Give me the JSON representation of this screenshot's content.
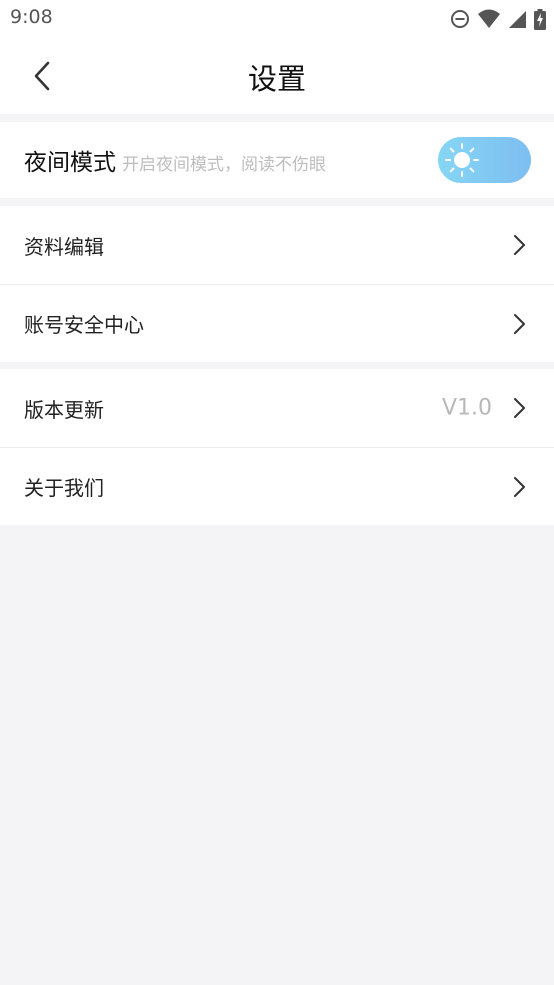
{
  "status_bar": {
    "time": "9:08",
    "icons": [
      "do-not-disturb-icon",
      "wifi-icon",
      "signal-icon",
      "battery-charging-icon"
    ]
  },
  "header": {
    "title": "设置",
    "back_icon": "chevron-left-icon"
  },
  "night_mode": {
    "label": "夜间模式",
    "hint": "开启夜间模式，阅读不伤眼",
    "enabled": false,
    "toggle_icon": "sun-icon",
    "toggle_color": "#7fc6f3"
  },
  "groups": {
    "profile": {
      "items": [
        {
          "label": "资料编辑"
        },
        {
          "label": "账号安全中心"
        }
      ]
    },
    "about": {
      "items": [
        {
          "label": "版本更新",
          "value": "V1.0"
        },
        {
          "label": "关于我们"
        }
      ]
    }
  },
  "colors": {
    "background": "#f4f4f6",
    "card": "#ffffff",
    "secondary_text": "#bdbdbd"
  }
}
